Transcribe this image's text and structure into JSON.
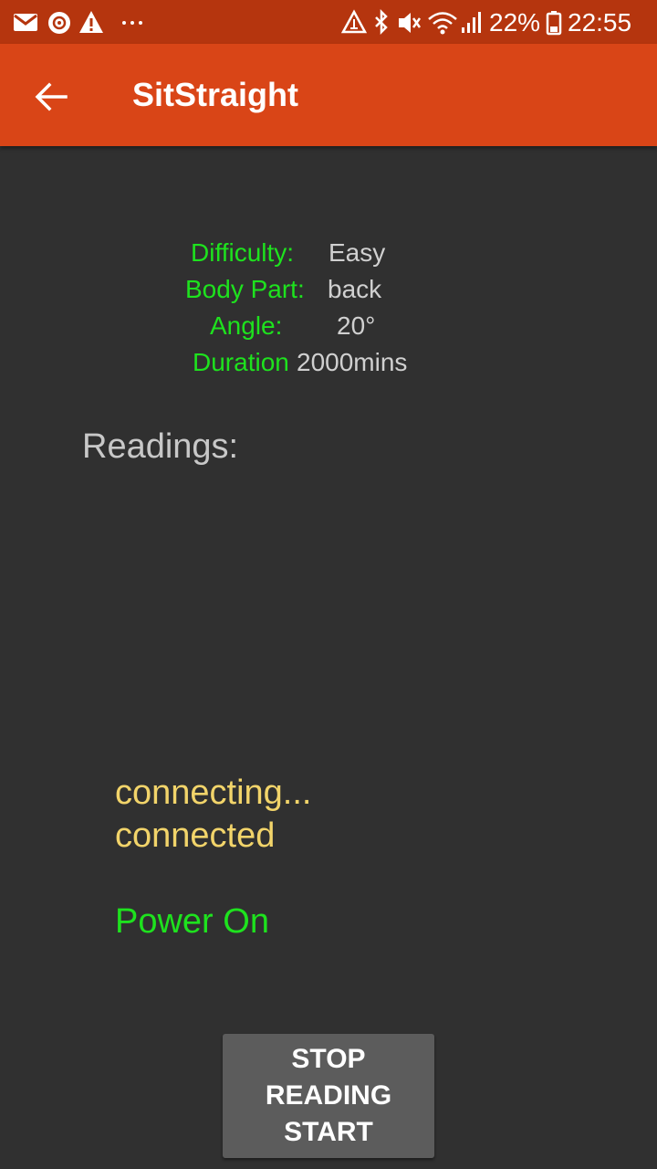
{
  "status_bar": {
    "icons_left": [
      "mail-icon",
      "settings-notification-icon",
      "warning-icon",
      "more-dots-icon"
    ],
    "icons_right": [
      "data-saver-icon",
      "bluetooth-icon",
      "mute-icon",
      "wifi-icon",
      "signal-icon",
      "battery-icon"
    ],
    "battery_percent": "22%",
    "time": "22:55"
  },
  "app_bar": {
    "title": "SitStraight",
    "back_icon": "arrow-back-icon",
    "color": "#d94517"
  },
  "info": {
    "difficulty_label": "Difficulty:",
    "difficulty_value": "Easy",
    "body_part_label": "Body Part:",
    "body_part_value": "back",
    "angle_label": "Angle:",
    "angle_value": "20°",
    "duration_label": "Duration",
    "duration_value": "2000mins"
  },
  "readings_label": "Readings:",
  "log": {
    "line1": "connecting...",
    "line2": "connected"
  },
  "power_status": "Power On",
  "button": {
    "line1": "STOP",
    "line2": "READING",
    "line3": "START"
  },
  "colors": {
    "status_bar": "#b5350e",
    "background": "#303030",
    "label_green": "#1ee21e",
    "log_yellow": "#f2d46a",
    "button_gray": "#5c5c5c"
  }
}
